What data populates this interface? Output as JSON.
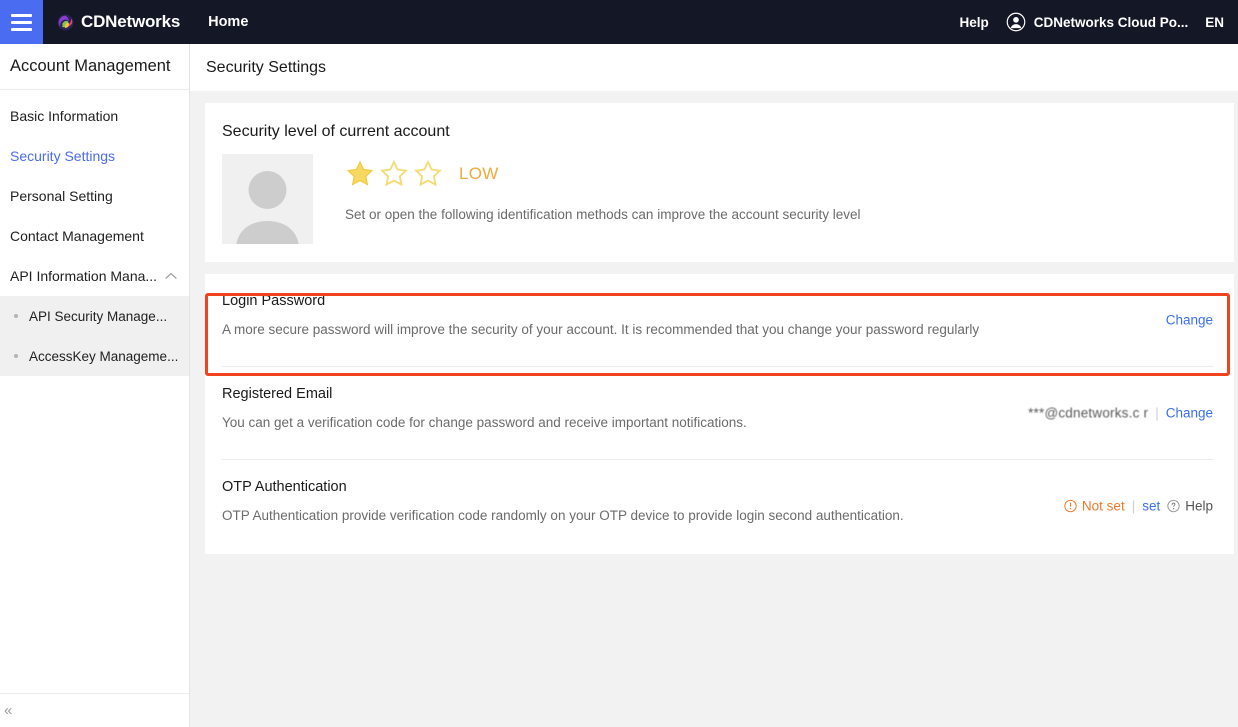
{
  "topbar": {
    "menu_icon": "hamburger-icon",
    "logo_icon": "cdnetworks-logo-icon",
    "brand": "CDNetworks",
    "home": "Home",
    "help": "Help",
    "user_icon": "user-avatar-icon",
    "account": "CDNetworks Cloud Po...",
    "language": "EN"
  },
  "sidebar": {
    "title": "Account Management",
    "items": [
      {
        "label": "Basic Information",
        "active": false
      },
      {
        "label": "Security Settings",
        "active": true
      },
      {
        "label": "Personal Setting",
        "active": false
      },
      {
        "label": "Contact Management",
        "active": false
      },
      {
        "label": "API Information Mana...",
        "active": false,
        "expanded": true,
        "caret_icon": "chevron-up-icon"
      }
    ],
    "subitems": [
      {
        "label": "API Security Manage..."
      },
      {
        "label": "AccessKey Manageme..."
      }
    ],
    "collapse_icon": "collapse-left-icon",
    "collapse_label": "«"
  },
  "page": {
    "title": "Security Settings"
  },
  "security_level": {
    "card_title": "Security level of current account",
    "avatar_icon": "avatar-placeholder-icon",
    "stars_filled": 1,
    "stars_total": 3,
    "level": "LOW",
    "description": "Set or open the following identification methods can improve the account security level",
    "star_color": "#f7d860",
    "level_color": "#f0a93c"
  },
  "rows": [
    {
      "name": "login-password",
      "title": "Login Password",
      "description": "A more secure password will improve the security of your account. It is recommended that you change your password regularly",
      "value": "",
      "change_label": "Change",
      "highlighted": true
    },
    {
      "name": "registered-email",
      "title": "Registered Email",
      "description": "You can get a verification code for change password and receive important notifications.",
      "value": "***@cdnetworks.c  r",
      "change_label": "Change",
      "highlighted": false
    },
    {
      "name": "otp-authentication",
      "title": "OTP Authentication",
      "description": "OTP Authentication provide verification code randomly on your OTP device to provide login second authentication.",
      "status": "Not set",
      "status_icon": "warning-circle-icon",
      "set_label": "set",
      "help_label": "Help",
      "help_icon": "question-circle-icon",
      "highlighted": false
    }
  ],
  "colors": {
    "accent": "#4a6cf0",
    "link": "#3b6ef0",
    "warning": "#f0792b",
    "highlight": "#f0441e",
    "topbar_bg": "#141826"
  }
}
